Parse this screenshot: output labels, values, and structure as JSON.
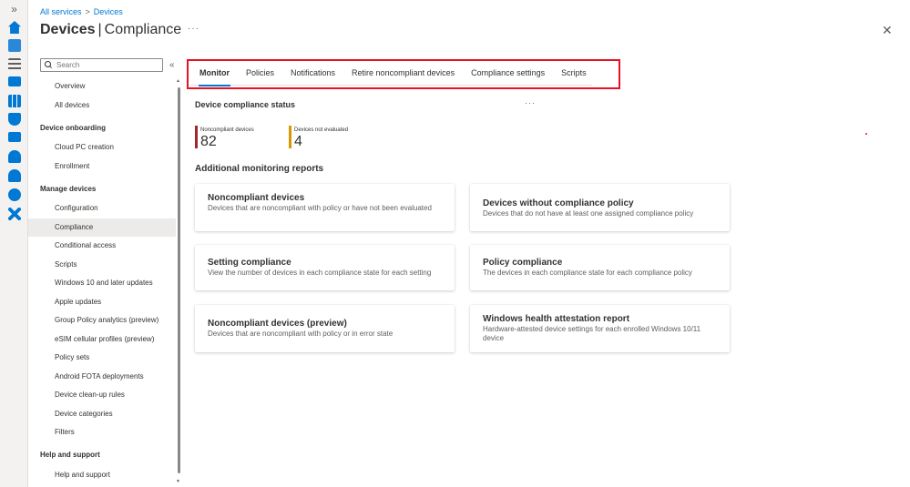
{
  "rail": {
    "expand_glyph": "»",
    "icons": [
      {
        "name": "home-icon",
        "color": "#0078d4"
      },
      {
        "name": "dashboard-icon",
        "color": "#2b88d8"
      },
      {
        "name": "all-services-icon",
        "color": "#605e5c"
      },
      {
        "name": "devices-icon",
        "color": "#0078d4"
      },
      {
        "name": "apps-icon",
        "color": "#0078d4"
      },
      {
        "name": "endpoint-security-icon",
        "color": "#0078d4"
      },
      {
        "name": "reports-icon",
        "color": "#0078d4"
      },
      {
        "name": "users-icon",
        "color": "#0078d4"
      },
      {
        "name": "groups-icon",
        "color": "#0078d4"
      },
      {
        "name": "tenant-admin-icon",
        "color": "#0078d4"
      },
      {
        "name": "troubleshooting-icon",
        "color": "#0078d4"
      }
    ]
  },
  "breadcrumb": {
    "items": [
      "All services",
      "Devices"
    ],
    "separator": ">"
  },
  "header": {
    "title_bold": "Devices",
    "title_sep": "|",
    "title_rest": "Compliance",
    "more": "···",
    "close": "✕"
  },
  "search": {
    "placeholder": "Search"
  },
  "collapse_glyph": "«",
  "nav": {
    "top_items": [
      "Overview",
      "All devices"
    ],
    "groups": [
      {
        "label": "Device onboarding",
        "items": [
          "Cloud PC creation",
          "Enrollment"
        ]
      },
      {
        "label": "Manage devices",
        "items": [
          "Configuration",
          "Compliance",
          "Conditional access",
          "Scripts",
          "Windows 10 and later updates",
          "Apple updates",
          "Group Policy analytics (preview)",
          "eSIM cellular profiles (preview)",
          "Policy sets",
          "Android FOTA deployments",
          "Device clean-up rules",
          "Device categories",
          "Filters"
        ]
      },
      {
        "label": "Help and support",
        "items": [
          "Help and support"
        ]
      }
    ],
    "active": "Compliance"
  },
  "tabs": {
    "items": [
      "Monitor",
      "Policies",
      "Notifications",
      "Retire noncompliant devices",
      "Compliance settings",
      "Scripts"
    ],
    "active": "Monitor",
    "highlight_color": "#e81123"
  },
  "status": {
    "title": "Device compliance status",
    "more": "···",
    "metrics": [
      {
        "label": "Noncompliant devices",
        "value": "82",
        "color": "#a4262c"
      },
      {
        "label": "Devices not evaluated",
        "value": "4",
        "color": "#d69a00"
      }
    ]
  },
  "reports": {
    "title": "Additional monitoring reports",
    "cards": [
      {
        "title": "Noncompliant devices",
        "desc": "Devices that are noncompliant with policy or have not been evaluated"
      },
      {
        "title": "Devices without compliance policy",
        "desc": "Devices that do not have at least one assigned compliance policy"
      },
      {
        "title": "Setting compliance",
        "desc": "View the number of devices in each compliance state for each setting"
      },
      {
        "title": "Policy compliance",
        "desc": "The devices in each compliance state for each compliance policy"
      },
      {
        "title": "Noncompliant devices (preview)",
        "desc": "Devices that are noncompliant with policy or in error state"
      },
      {
        "title": "Windows health attestation report",
        "desc": "Hardware-attested device settings for each enrolled Windows 10/11 device"
      }
    ]
  },
  "colors": {
    "accent": "#0078d4",
    "text": "#323130",
    "muted": "#605e5c"
  }
}
